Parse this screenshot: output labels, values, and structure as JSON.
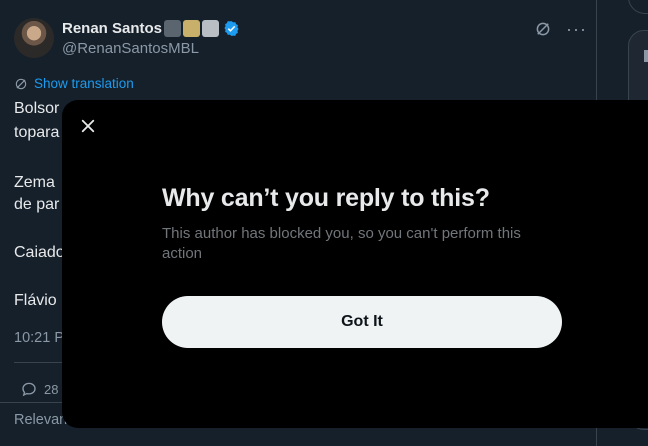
{
  "tweet": {
    "author": {
      "display_name": "Renan Santos",
      "handle": "@RenanSantosMBL",
      "name_emoji_colors": [
        "#5b6570",
        "#c8b06b",
        "#b9bec4"
      ],
      "verified_icon": "verified-badge-icon",
      "verified_color": "#1d9bf0"
    },
    "header_icons": [
      "grok-icon",
      "more-icon"
    ],
    "more_label": "···",
    "translate_label": "Show translation",
    "visible_lines": [
      "Bolsor",
      "topara",
      "Zema",
      "de par",
      "Caiado",
      "Flávio"
    ],
    "timestamp": "10:21 P",
    "reply_count": "28",
    "sort_label": "Relevan"
  },
  "modal": {
    "title": "Why can’t you reply to this?",
    "body": "This author has blocked you, so you can't perform this action",
    "button_label": "Got It",
    "close_icon": "close-icon"
  },
  "colors": {
    "background": "#15202b",
    "modal_background": "#000000",
    "accent": "#1d9bf0",
    "button_background": "#eff3f4",
    "muted_text": "#71767b"
  }
}
